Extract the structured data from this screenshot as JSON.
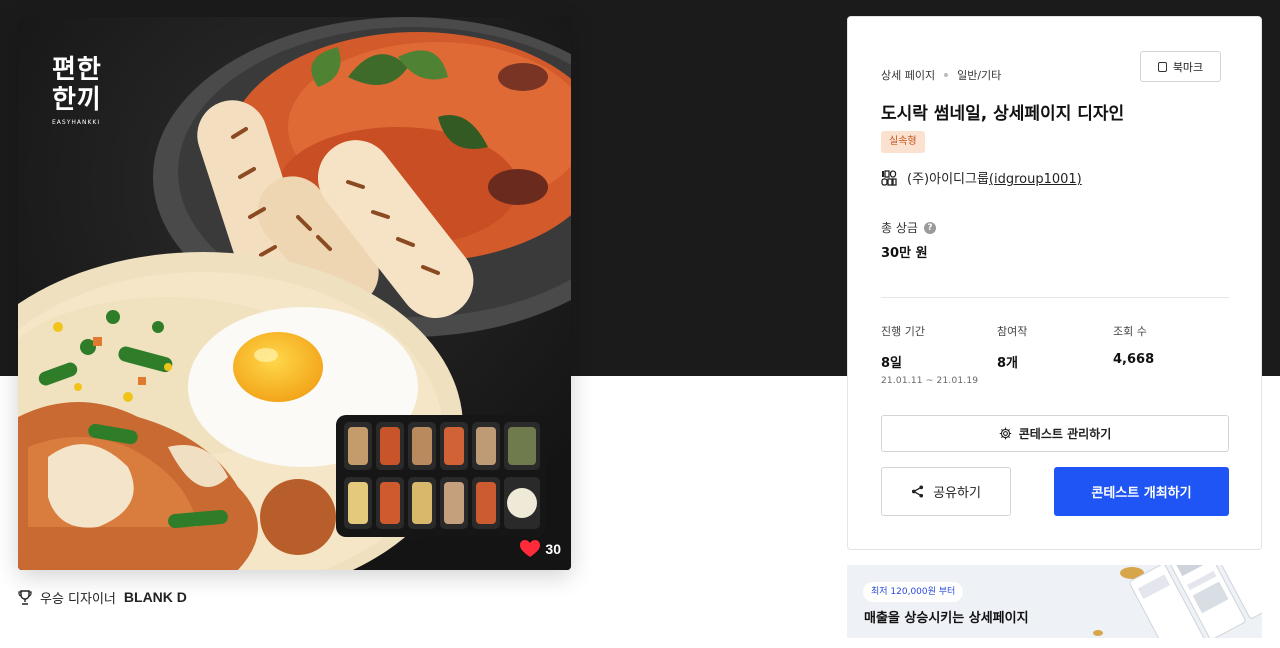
{
  "hero": {
    "brand_logo_ko_line1": "편한",
    "brand_logo_ko_line2": "한끼",
    "brand_logo_en": "EASYHANKKI",
    "likes": "30",
    "icons": {
      "like": "heart-icon"
    },
    "colors": {
      "heart": "#ff2b3b",
      "background": "#1e1e1e"
    }
  },
  "winner": {
    "label": "우승 디자이너",
    "name": "BLANK D",
    "icon": "trophy-icon"
  },
  "panel": {
    "breadcrumb": [
      "상세 페이지",
      "일반/기타"
    ],
    "bookmark_label": "북마크",
    "title": "도시락 썸네일, 상세페이지 디자인",
    "tag": "실속형",
    "company_logo_text": "IDGROUP",
    "company_name": "(주)아이디그룹",
    "company_handle": "(idgroup1001)",
    "prize": {
      "label": "총 상금",
      "value": "30만 원"
    },
    "stats": [
      {
        "label": "진행 기간",
        "value": "8일",
        "sub": "21.01.11 ~ 21.01.19"
      },
      {
        "label": "참여작",
        "value": "8개"
      },
      {
        "label": "조회 수",
        "value": "4,668"
      }
    ],
    "manage_label": "콘테스트 관리하기",
    "share_label": "공유하기",
    "host_label": "콘테스트 개최하기",
    "colors": {
      "primary": "#1f55f5",
      "tag_bg": "#fbe1cf",
      "tag_text": "#c0561d"
    }
  },
  "ad": {
    "pill": "최저 120,000원 부터",
    "headline": "매출을 상승시키는 상세페이지"
  }
}
